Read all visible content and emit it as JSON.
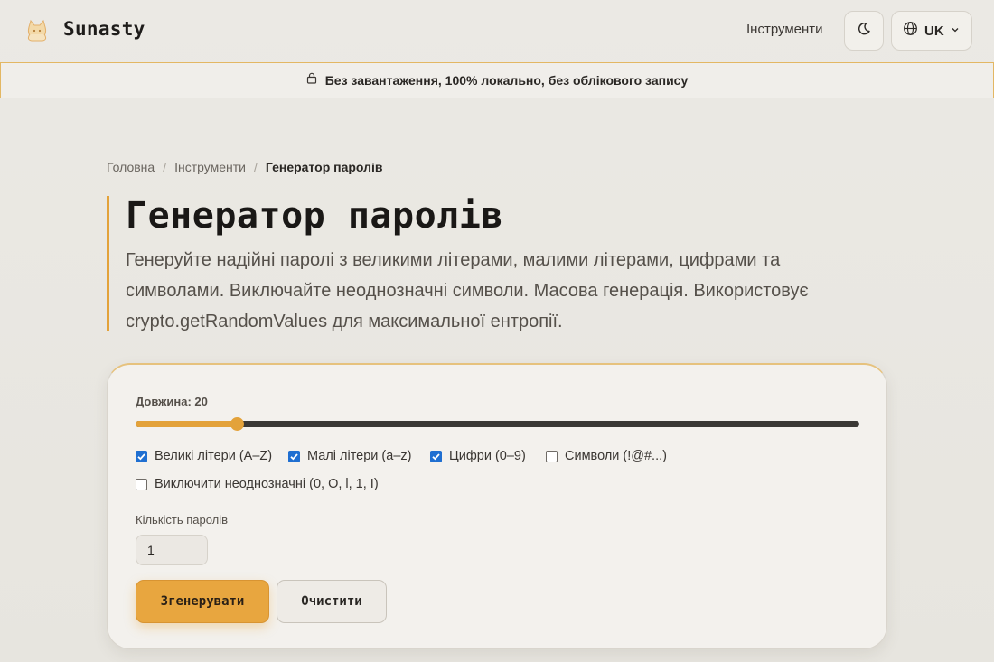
{
  "header": {
    "brand": "Sunasty",
    "logo_icon": "cat-icon",
    "nav_tools": "Інструменти",
    "theme_icon": "moon-icon",
    "lang_icon": "globe-icon",
    "lang_label": "UK",
    "lang_chevron": "chevron-down-icon"
  },
  "banner": {
    "icon": "lock-icon",
    "text": "Без завантаження, 100% локально, без облікового запису"
  },
  "breadcrumb": {
    "home": "Головна",
    "tools": "Інструменти",
    "current": "Генератор паролів",
    "separator": "/"
  },
  "page": {
    "title": "Генератор паролів",
    "description": "Генеруйте надійні паролі з великими літерами, малими літерами, цифрами та символами. Виключайте неоднозначні символи. Масова генерація. Використовує crypto.getRandomValues для максимальної ентропії."
  },
  "form": {
    "length_label": "Довжина: 20",
    "length_value": 20,
    "length_fraction": 0.14,
    "options": [
      {
        "label": "Великі літери (A–Z)",
        "checked": true
      },
      {
        "label": "Малі літери (a–z)",
        "checked": true
      },
      {
        "label": "Цифри (0–9)",
        "checked": true
      },
      {
        "label": "Символи (!@#...)",
        "checked": false
      },
      {
        "label": "Виключити неоднозначні (0, O, l, 1, I)",
        "checked": false
      }
    ],
    "count_label": "Кількість паролів",
    "count_value": "1",
    "generate_label": "Згенерувати",
    "clear_label": "Очистити"
  },
  "colors": {
    "accent": "#e3a23a",
    "checkbox": "#1f6fd1",
    "background": "#e9e7e2"
  }
}
